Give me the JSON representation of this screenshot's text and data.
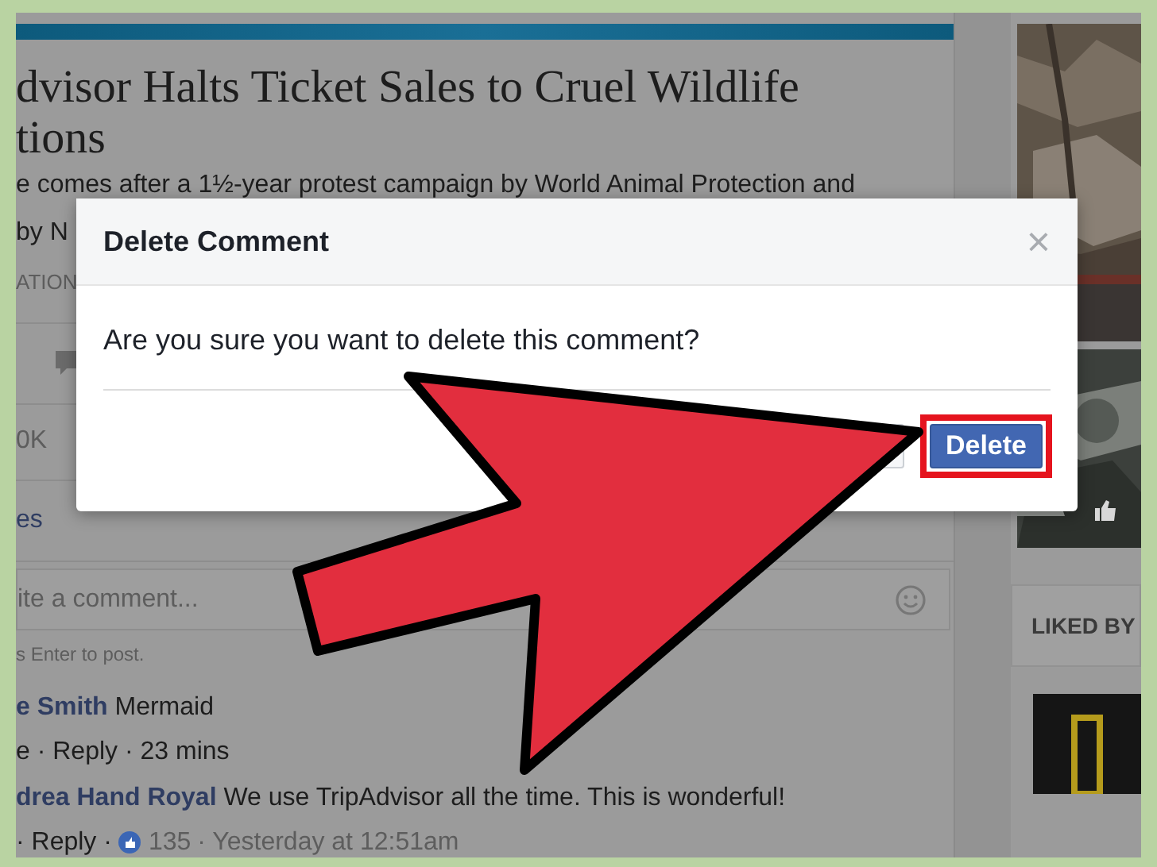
{
  "post": {
    "headline_lines": [
      "dvisor Halts Ticket Sales to Cruel Wildlife",
      "tions"
    ],
    "summary": "e comes after a 1½-year protest campaign by World Animal Protection and",
    "byline": "by N",
    "source": "ATION",
    "reaction_count": "0K",
    "shares_link": "es"
  },
  "comment_box": {
    "placeholder": "ite a comment...",
    "hint": "s Enter to post."
  },
  "comments": [
    {
      "author": "e Smith",
      "text": "Mermaid",
      "meta": "e · Reply · 23 mins"
    },
    {
      "author": "drea Hand Royal",
      "text": "We use TripAdvisor all the time. This is wonderful!",
      "meta": "· Reply ·",
      "likes": "135",
      "time": "· Yesterday at 12:51am"
    }
  ],
  "sidebar": {
    "heading": "LIKED BY"
  },
  "dialog": {
    "title": "Delete Comment",
    "close": "×",
    "message": "Are you sure you want to delete this comment?",
    "buttons": [
      {
        "kind": "secondary",
        "highlighted": false
      },
      {
        "kind": "primary",
        "label": "Delete",
        "highlighted": true
      }
    ]
  }
}
